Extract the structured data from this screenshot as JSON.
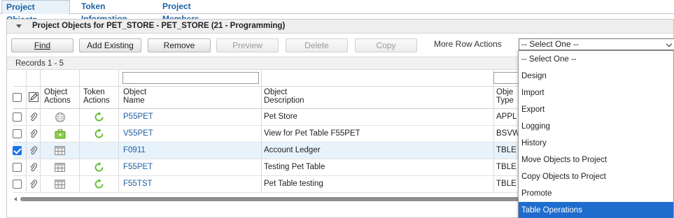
{
  "tabs": [
    {
      "label": "Project Objects",
      "active": true
    },
    {
      "label": "Token Information",
      "active": false
    },
    {
      "label": "Project Members",
      "active": false
    }
  ],
  "panel": {
    "title": "Project Objects for PET_STORE - PET_STORE  (21 - Programming)"
  },
  "toolbar": {
    "find": "Find",
    "add_existing": "Add Existing",
    "remove": "Remove",
    "preview": "Preview",
    "delete": "Delete",
    "copy": "Copy",
    "more_row_actions": "More Row Actions",
    "select_value": "-- Select One --"
  },
  "records": "Records 1 - 5",
  "columns": {
    "object_actions": [
      "Object",
      "Actions"
    ],
    "token_actions": [
      "Token",
      "Actions"
    ],
    "object_name": [
      "Object",
      "Name"
    ],
    "object_description": [
      "Object",
      "Description"
    ],
    "object_type": [
      "Obje",
      "Type"
    ]
  },
  "rows": [
    {
      "name": "P55PET",
      "description": "Pet Store",
      "type": "APPL",
      "checked": false,
      "object_icon": "globe-icon",
      "token": true
    },
    {
      "name": "V55PET",
      "description": "View for Pet Table F55PET",
      "type": "BSVW",
      "checked": false,
      "object_icon": "briefcase-icon",
      "token": true
    },
    {
      "name": "F0911",
      "description": "Account Ledger",
      "type": "TBLE",
      "checked": true,
      "object_icon": "table-icon",
      "token": false
    },
    {
      "name": "F55PET",
      "description": "Testing Pet Table",
      "type": "TBLE",
      "checked": false,
      "object_icon": "table-icon",
      "token": true
    },
    {
      "name": "F55TST",
      "description": "Pet Table testing",
      "type": "TBLE",
      "checked": false,
      "object_icon": "table-icon",
      "token": true
    }
  ],
  "dropdown": {
    "options": [
      "-- Select One --",
      "Design",
      "Import",
      "Export",
      "Logging",
      "History",
      "Move Objects to Project",
      "Copy Objects to Project",
      "Promote",
      "Table Operations"
    ],
    "highlighted": "Table Operations"
  },
  "colors": {
    "link": "#1c5ea0",
    "highlight": "#1e6ccd",
    "checkbox": "#1a73e8",
    "token_refresh": "#5dbb2c"
  }
}
